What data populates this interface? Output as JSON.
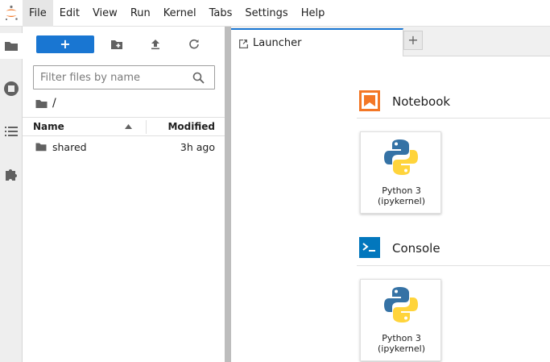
{
  "menubar": {
    "items": [
      "File",
      "Edit",
      "View",
      "Run",
      "Kernel",
      "Tabs",
      "Settings",
      "Help"
    ],
    "active": "File"
  },
  "activity": [
    "folder-icon",
    "running-icon",
    "toc-icon",
    "extension-icon"
  ],
  "filebrowser": {
    "new_label": "+",
    "search_placeholder": "Filter files by name",
    "breadcrumb": "/",
    "columns": {
      "name": "Name",
      "modified": "Modified"
    },
    "rows": [
      {
        "name": "shared",
        "modified": "3h ago",
        "type": "folder"
      }
    ]
  },
  "tabs": [
    {
      "label": "Launcher"
    }
  ],
  "add_tab_label": "+",
  "launcher": {
    "sections": [
      {
        "title": "Notebook",
        "cards": [
          {
            "line1": "Python 3",
            "line2": "(ipykernel)"
          }
        ]
      },
      {
        "title": "Console",
        "cards": [
          {
            "line1": "Python 3",
            "line2": "(ipykernel)"
          }
        ]
      }
    ]
  },
  "colors": {
    "accent": "#1976d2",
    "notebook_icon": "#f37726",
    "console_icon": "#0277bd"
  }
}
